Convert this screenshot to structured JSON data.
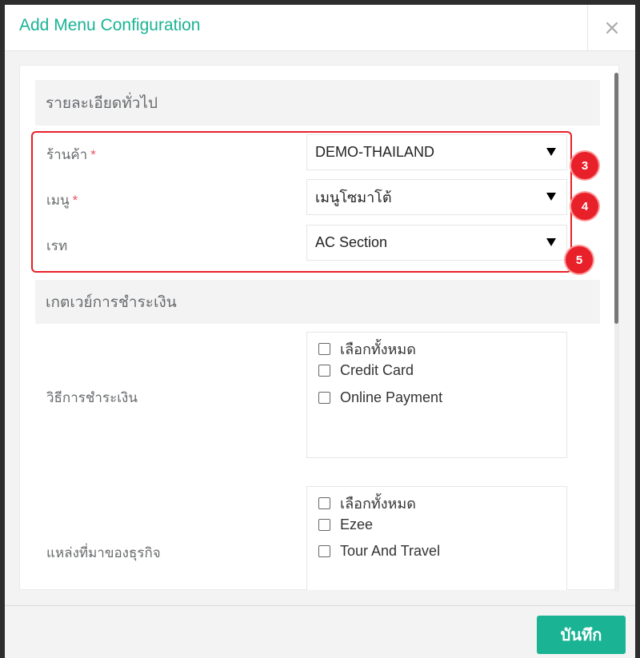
{
  "modal": {
    "title": "Add Menu Configuration",
    "close_label": "×"
  },
  "sections": {
    "general": "รายละเอียดทั่วไป",
    "payment": "เกตเวย์การชำระเงิน"
  },
  "form": {
    "store": {
      "label": "ร้านค้า",
      "required_mark": "*",
      "value": "DEMO-THAILAND"
    },
    "menu": {
      "label": "เมนู",
      "required_mark": "*",
      "value": "เมนูโซมาโต้"
    },
    "rate": {
      "label": "เรท",
      "value": "AC Section"
    }
  },
  "annotations": [
    "3",
    "4",
    "5"
  ],
  "payment_methods": {
    "label": "วิธีการชำระเงิน",
    "options": [
      "เลือกทั้งหมด",
      "Credit Card",
      "Online Payment"
    ]
  },
  "business_sources": {
    "label": "แหล่งที่มาของธุรกิจ",
    "options": [
      "เลือกทั้งหมด",
      "Ezee",
      "Tour And Travel"
    ]
  },
  "footer": {
    "save_label": "บันทึก"
  },
  "colors": {
    "accent": "#1ab394",
    "annotation": "#e8202a",
    "required": "#ed5565"
  }
}
